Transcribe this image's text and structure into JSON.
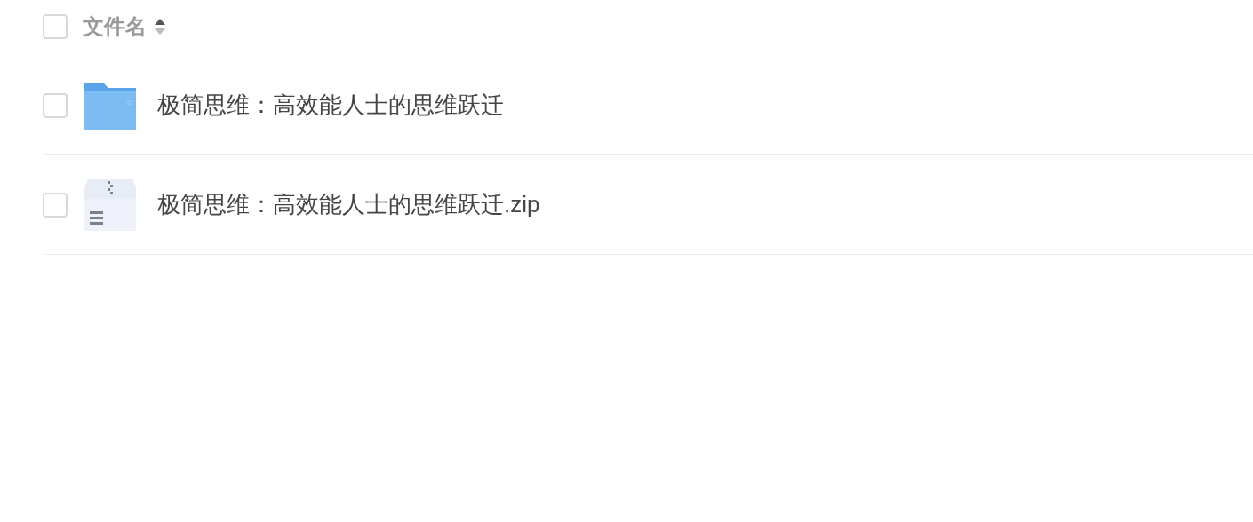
{
  "header": {
    "checked": false,
    "label": "文件名",
    "sort_ascending": true
  },
  "files": [
    {
      "kind": "folder",
      "name": "极简思维：高效能人士的思维跃迁",
      "checked": false
    },
    {
      "kind": "zip",
      "name": "极简思维：高效能人士的思维跃迁.zip",
      "checked": false
    }
  ]
}
